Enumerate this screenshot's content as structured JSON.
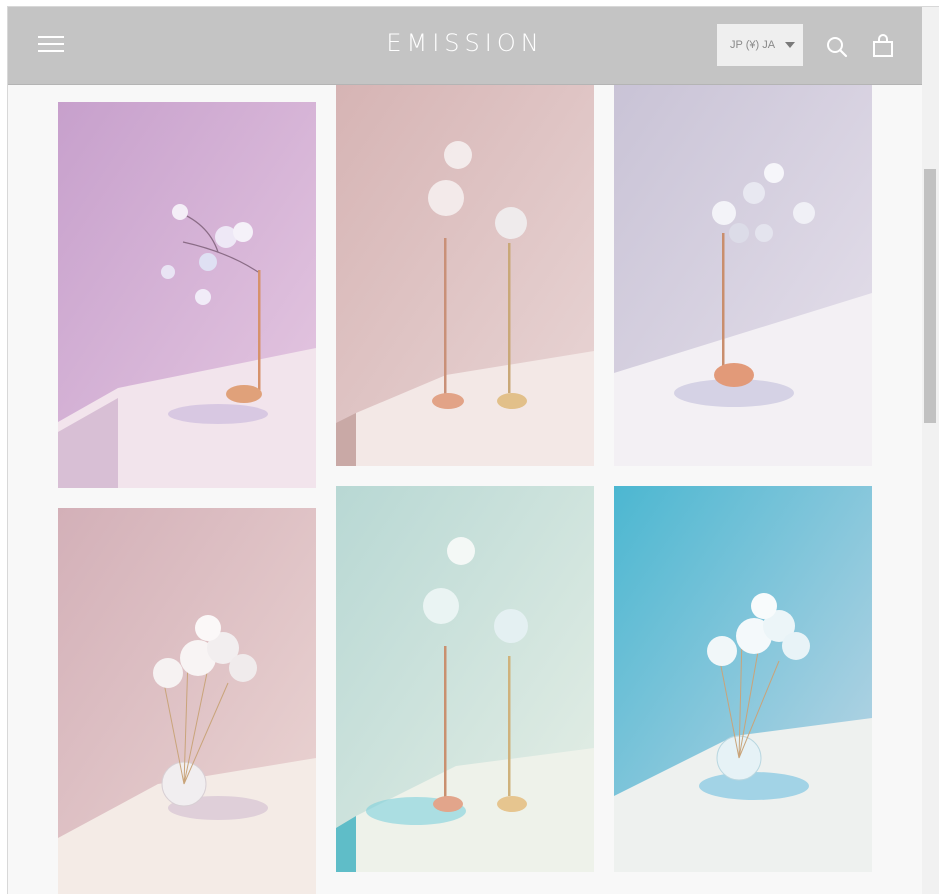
{
  "header": {
    "logo": "EMISSION",
    "locale_label": "JP (¥) JA"
  },
  "icons": {
    "menu": "hamburger-menu-icon",
    "search": "search-icon",
    "cart": "shopping-bag-icon",
    "locale_caret": "caret-down-icon"
  },
  "colors": {
    "header_bg": "#c4c4c4",
    "page_bg": "#f8f8f8",
    "logo": "#ffffff"
  },
  "gallery": {
    "items": [
      {
        "alt": "lilac-branch-flowers-copper-stand"
      },
      {
        "alt": "two-flower-stems-copper-brass-bases"
      },
      {
        "alt": "silver-branch-flowers-copper-base"
      },
      {
        "alt": "clear-bouquet-glass-sphere-pink"
      },
      {
        "alt": "two-flower-stems-mint-background"
      },
      {
        "alt": "clear-bouquet-glass-sphere-blue"
      }
    ]
  }
}
